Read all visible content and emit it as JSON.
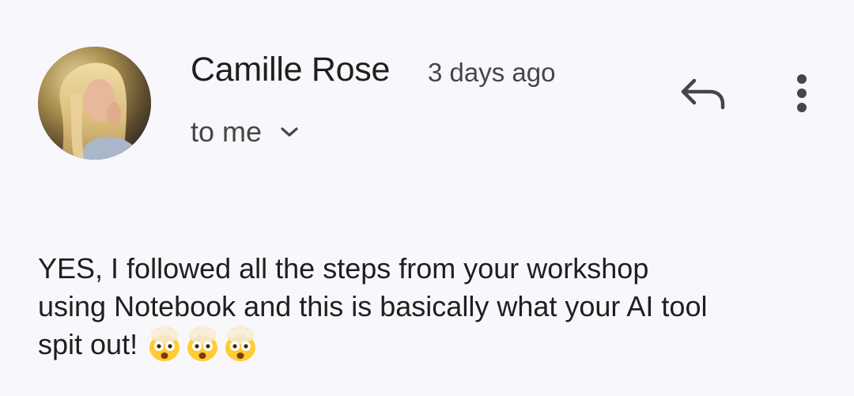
{
  "message": {
    "sender_name": "Camille Rose",
    "timestamp": "3 days ago",
    "recipient_label": "to me",
    "body_lines": [
      "YES, I followed all the steps from your workshop",
      "using Notebook and this is basically what your AI tool",
      "spit out!"
    ],
    "emoji_count": 3,
    "emoji_name": "exploding-head-emoji"
  },
  "icons": {
    "reply": "reply-icon",
    "more": "more-vert-icon",
    "expand": "chevron-down-icon"
  },
  "colors": {
    "background": "#f8f8fc",
    "primary_text": "#1f1f1f",
    "secondary_text": "#444746"
  }
}
